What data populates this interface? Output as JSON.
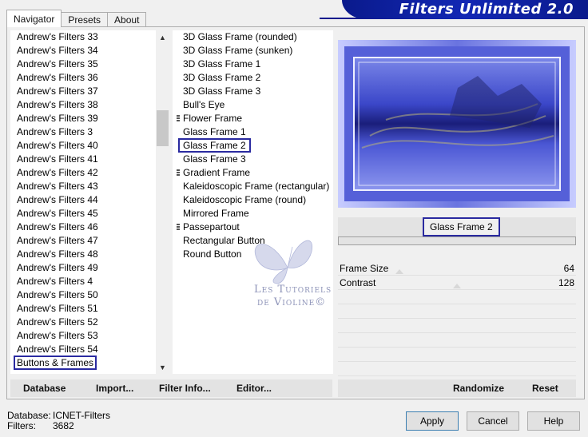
{
  "tabs": [
    {
      "label": "Navigator"
    },
    {
      "label": "Presets"
    },
    {
      "label": "About"
    }
  ],
  "app_title": "Filters Unlimited 2.0",
  "categories": [
    "Andrew's Filters 33",
    "Andrew's Filters 34",
    "Andrew's Filters 35",
    "Andrew's Filters 36",
    "Andrew's Filters 37",
    "Andrew's Filters 38",
    "Andrew's Filters 39",
    "Andrew's Filters 3",
    "Andrew's Filters 40",
    "Andrew's Filters 41",
    "Andrew's Filters 42",
    "Andrew's Filters 43",
    "Andrew's Filters 44",
    "Andrew's Filters 45",
    "Andrew's Filters 46",
    "Andrew's Filters 47",
    "Andrew's Filters 48",
    "Andrew's Filters 49",
    "Andrew's Filters 4",
    "Andrew's Filters 50",
    "Andrew's Filters 51",
    "Andrew's Filters 52",
    "Andrew's Filters 53",
    "Andrew's Filters 54",
    "Buttons & Frames"
  ],
  "selected_category_index": 24,
  "filters": [
    {
      "label": "3D Glass Frame (rounded)",
      "group": false
    },
    {
      "label": "3D Glass Frame (sunken)",
      "group": false
    },
    {
      "label": "3D Glass Frame 1",
      "group": false
    },
    {
      "label": "3D Glass Frame 2",
      "group": false
    },
    {
      "label": "3D Glass Frame 3",
      "group": false
    },
    {
      "label": "Bull's Eye",
      "group": false
    },
    {
      "label": "Flower Frame",
      "group": true
    },
    {
      "label": "Glass Frame 1",
      "group": false
    },
    {
      "label": "Glass Frame 2",
      "group": false
    },
    {
      "label": "Glass Frame 3",
      "group": false
    },
    {
      "label": "Gradient Frame",
      "group": true
    },
    {
      "label": "Kaleidoscopic Frame (rectangular)",
      "group": false
    },
    {
      "label": "Kaleidoscopic Frame (round)",
      "group": false
    },
    {
      "label": "Mirrored Frame",
      "group": false
    },
    {
      "label": "Passepartout",
      "group": true
    },
    {
      "label": "Rectangular Button",
      "group": false
    },
    {
      "label": "Round Button",
      "group": false
    }
  ],
  "selected_filter_index": 8,
  "selected_filter_name": "Glass Frame 2",
  "parameters": [
    {
      "label": "Frame Size",
      "value": "64",
      "level": 0.25
    },
    {
      "label": "Contrast",
      "value": "128",
      "level": 0.5
    }
  ],
  "bottom_left_buttons": {
    "database": "Database",
    "import": "Import...",
    "filter_info": "Filter Info...",
    "editor": "Editor..."
  },
  "bottom_right_buttons": {
    "randomize": "Randomize",
    "reset": "Reset"
  },
  "status": {
    "database_key": "Database:",
    "database_value": "ICNET-Filters",
    "filters_key": "Filters:",
    "filters_value": "3682"
  },
  "dialog_buttons": {
    "apply": "Apply",
    "cancel": "Cancel",
    "help": "Help"
  },
  "watermark": {
    "line1": "Les Tutoriels",
    "line2": "de Violine©"
  },
  "colors": {
    "accent": "#2a2aa0",
    "banner": "#1227b4"
  }
}
